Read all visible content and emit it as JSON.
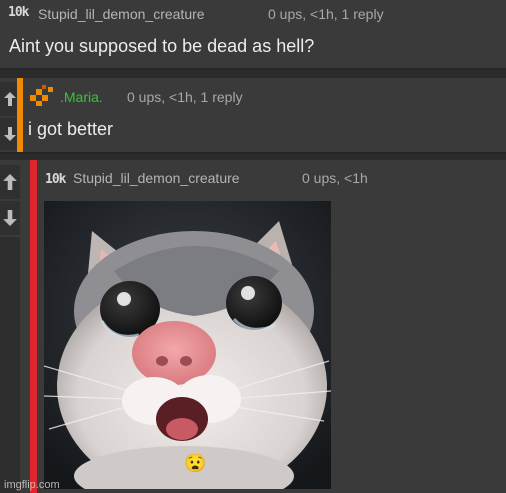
{
  "comments": [
    {
      "rank": "10k",
      "username": "Stupid_lil_demon_creature",
      "meta": "0 ups, <1h, 1 reply",
      "text": "Aint you supposed to be dead as hell?"
    },
    {
      "username": ".Maria.",
      "meta": "0 ups, <1h, 1 reply",
      "text": "i got better",
      "accent_color": "#f08a00",
      "name_color": "#39c439"
    },
    {
      "rank": "10k",
      "username": "Stupid_lil_demon_creature",
      "meta": "0 ups, <1h",
      "image": "cat-meme-image",
      "accent_color": "#e0262c",
      "emoji": "😧"
    }
  ],
  "watermark": "imgflip.com"
}
